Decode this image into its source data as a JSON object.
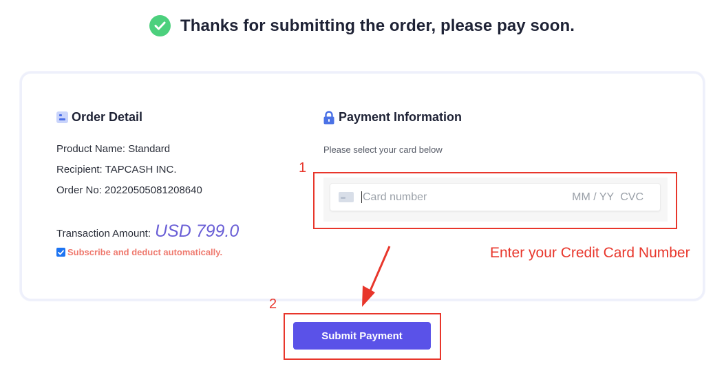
{
  "header": {
    "title": "Thanks for submitting the order, please pay soon."
  },
  "order": {
    "title": "Order Detail",
    "product_line": "Product Name: Standard",
    "recipient_line": "Recipient: TAPCASH INC.",
    "order_no_line": "Order No: 20220505081208640",
    "amount_label": "Transaction Amount:",
    "amount_value": "USD 799.0",
    "subscribe_label": "Subscribe and deduct automatically.",
    "subscribe_checked": true
  },
  "payment": {
    "title": "Payment Information",
    "hint": "Please select your card below",
    "card_number_placeholder": "Card number",
    "expiry_placeholder": "MM / YY",
    "cvc_placeholder": "CVC"
  },
  "annotations": {
    "step1": "1",
    "step2": "2",
    "instruction": "Enter your Credit Card Number"
  },
  "submit_label": "Submit Payment",
  "colors": {
    "accent": "#5a52e8",
    "success": "#4cd07d",
    "annotation_red": "#e8362b",
    "amount": "#6a5fd6",
    "subscribe_text": "#ef7a6f"
  }
}
